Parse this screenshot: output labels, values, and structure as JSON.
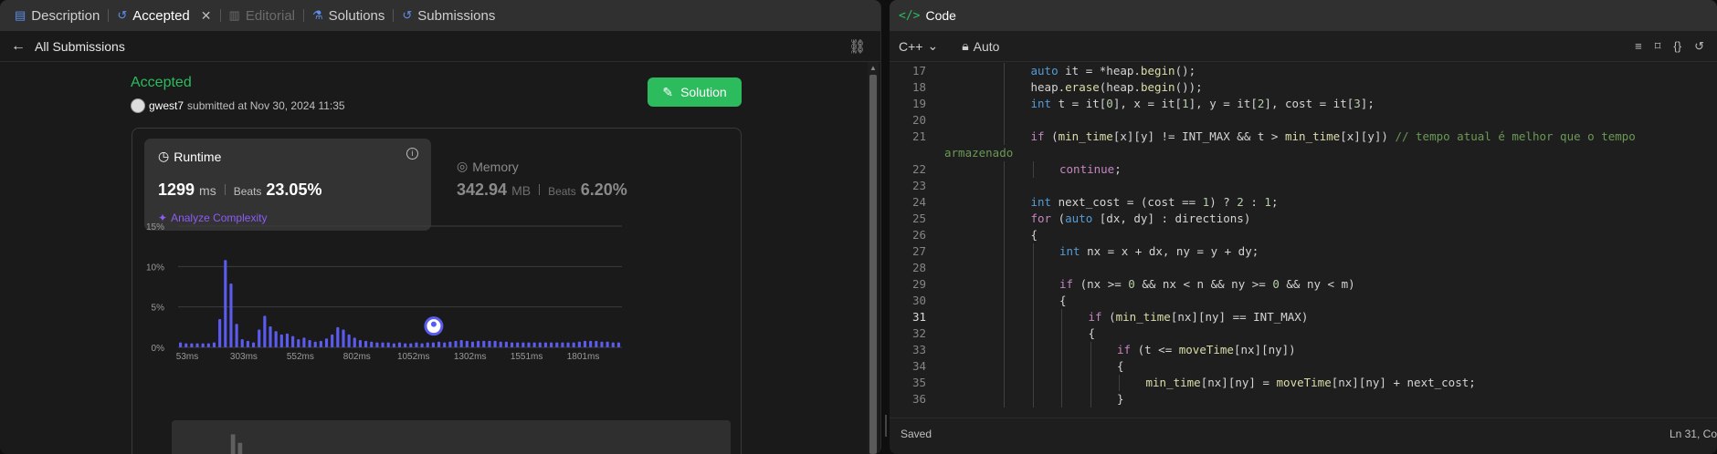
{
  "tabs": [
    {
      "label": "Description",
      "icon": "description-icon"
    },
    {
      "label": "Accepted",
      "icon": "history-icon"
    },
    {
      "label": "Editorial",
      "icon": "book-icon"
    },
    {
      "label": "Solutions",
      "icon": "flask-icon"
    },
    {
      "label": "Submissions",
      "icon": "history-icon"
    }
  ],
  "subbar": {
    "back_label": "All Submissions"
  },
  "submission": {
    "status": "Accepted",
    "username": "gwest7",
    "submitted_text": "submitted at Nov 30, 2024 11:35",
    "solution_button": "Solution"
  },
  "runtime": {
    "title": "Runtime",
    "value": "1299",
    "unit": "ms",
    "beats_label": "Beats",
    "beats_value": "23.05%",
    "analyze_label": "Analyze Complexity"
  },
  "memory": {
    "title": "Memory",
    "value": "342.94",
    "unit": "MB",
    "beats_label": "Beats",
    "beats_value": "6.20%"
  },
  "colors": {
    "accent_green": "#2cbb5d",
    "bar_blue": "#5b5bef",
    "purple": "#8b5cf6"
  },
  "chart_data": {
    "type": "bar",
    "ylabel_ticks": [
      "15%",
      "10%",
      "5%",
      "0%"
    ],
    "ylim": [
      0,
      15
    ],
    "xtick_labels": [
      "53ms",
      "303ms",
      "552ms",
      "802ms",
      "1052ms",
      "1302ms",
      "1551ms",
      "1801ms"
    ],
    "values": [
      0.6,
      0.5,
      0.5,
      0.5,
      0.5,
      0.5,
      0.6,
      3.5,
      10.8,
      7.9,
      2.9,
      1.0,
      0.8,
      0.6,
      2.2,
      3.9,
      2.6,
      2.0,
      1.6,
      1.7,
      1.4,
      1.0,
      1.2,
      0.9,
      0.7,
      0.8,
      1.1,
      1.6,
      2.5,
      2.2,
      1.6,
      1.2,
      0.9,
      0.8,
      0.7,
      0.6,
      0.6,
      0.6,
      0.5,
      0.6,
      0.5,
      0.5,
      0.6,
      0.5,
      0.6,
      0.6,
      0.7,
      0.6,
      0.7,
      0.8,
      0.9,
      0.8,
      0.7,
      0.8,
      0.8,
      0.8,
      0.8,
      0.7,
      0.7,
      0.6,
      0.6,
      0.6,
      0.6,
      0.6,
      0.6,
      0.6,
      0.6,
      0.6,
      0.6,
      0.6,
      0.6,
      0.7,
      0.8,
      0.8,
      0.8,
      0.7,
      0.7,
      0.6,
      0.6
    ],
    "marker_index": 45,
    "grid": true
  },
  "editor_header": {
    "title": "Code",
    "language": "C++",
    "mode": "Auto"
  },
  "code_lines": [
    {
      "n": "17",
      "indent": 3,
      "html": "<span class=\"ty\">auto</span> it = *heap.<span class=\"fn\">begin</span>();"
    },
    {
      "n": "18",
      "indent": 3,
      "html": "heap.<span class=\"fn\">erase</span>(heap.<span class=\"fn\">begin</span>());"
    },
    {
      "n": "19",
      "indent": 3,
      "html": "<span class=\"ty\">int</span> t = it[<span class=\"num\">0</span>], x = it[<span class=\"num\">1</span>], y = it[<span class=\"num\">2</span>], cost = it[<span class=\"num\">3</span>];"
    },
    {
      "n": "20",
      "indent": 3,
      "html": ""
    },
    {
      "n": "21",
      "indent": 3,
      "html": "<span class=\"kw\">if</span> (<span class=\"fn\">min_time</span>[x][y] != INT_MAX &amp;&amp; t &gt; <span class=\"fn\">min_time</span>[x][y]) <span class=\"cm\">// tempo atual é melhor que o tempo</span>"
    },
    {
      "n": "",
      "indent": 0,
      "html": "<span class=\"cm\">armazenado</span>"
    },
    {
      "n": "22",
      "indent": 4,
      "html": "<span class=\"kw\">continue</span>;"
    },
    {
      "n": "23",
      "indent": 3,
      "html": ""
    },
    {
      "n": "24",
      "indent": 3,
      "html": "<span class=\"ty\">int</span> next_cost = (cost == <span class=\"num\">1</span>) ? <span class=\"num\">2</span> : <span class=\"num\">1</span>;"
    },
    {
      "n": "25",
      "indent": 3,
      "html": "<span class=\"kw\">for</span> (<span class=\"ty\">auto</span> [dx, dy] : directions)"
    },
    {
      "n": "26",
      "indent": 3,
      "html": "{"
    },
    {
      "n": "27",
      "indent": 4,
      "html": "<span class=\"ty\">int</span> nx = x + dx, ny = y + dy;"
    },
    {
      "n": "28",
      "indent": 4,
      "html": ""
    },
    {
      "n": "29",
      "indent": 4,
      "html": "<span class=\"kw\">if</span> (nx &gt;= <span class=\"num\">0</span> &amp;&amp; nx &lt; n &amp;&amp; ny &gt;= <span class=\"num\">0</span> &amp;&amp; ny &lt; m)"
    },
    {
      "n": "30",
      "indent": 4,
      "html": "{"
    },
    {
      "n": "31",
      "indent": 5,
      "html": "<span class=\"kw\">if</span> (<span class=\"fn\">min_time</span>[nx][ny] == INT_MAX)"
    },
    {
      "n": "32",
      "indent": 5,
      "html": "{"
    },
    {
      "n": "33",
      "indent": 6,
      "html": "<span class=\"kw\">if</span> (t &lt;= <span class=\"fn\">moveTime</span>[nx][ny])"
    },
    {
      "n": "34",
      "indent": 6,
      "html": "{"
    },
    {
      "n": "35",
      "indent": 7,
      "html": "<span class=\"fn\">min_time</span>[nx][ny] = <span class=\"fn\">moveTime</span>[nx][ny] + next_cost;"
    },
    {
      "n": "36",
      "indent": 6,
      "html": "}"
    }
  ],
  "current_line": "31",
  "status": {
    "saved": "Saved",
    "position": "Ln 31, Co"
  }
}
